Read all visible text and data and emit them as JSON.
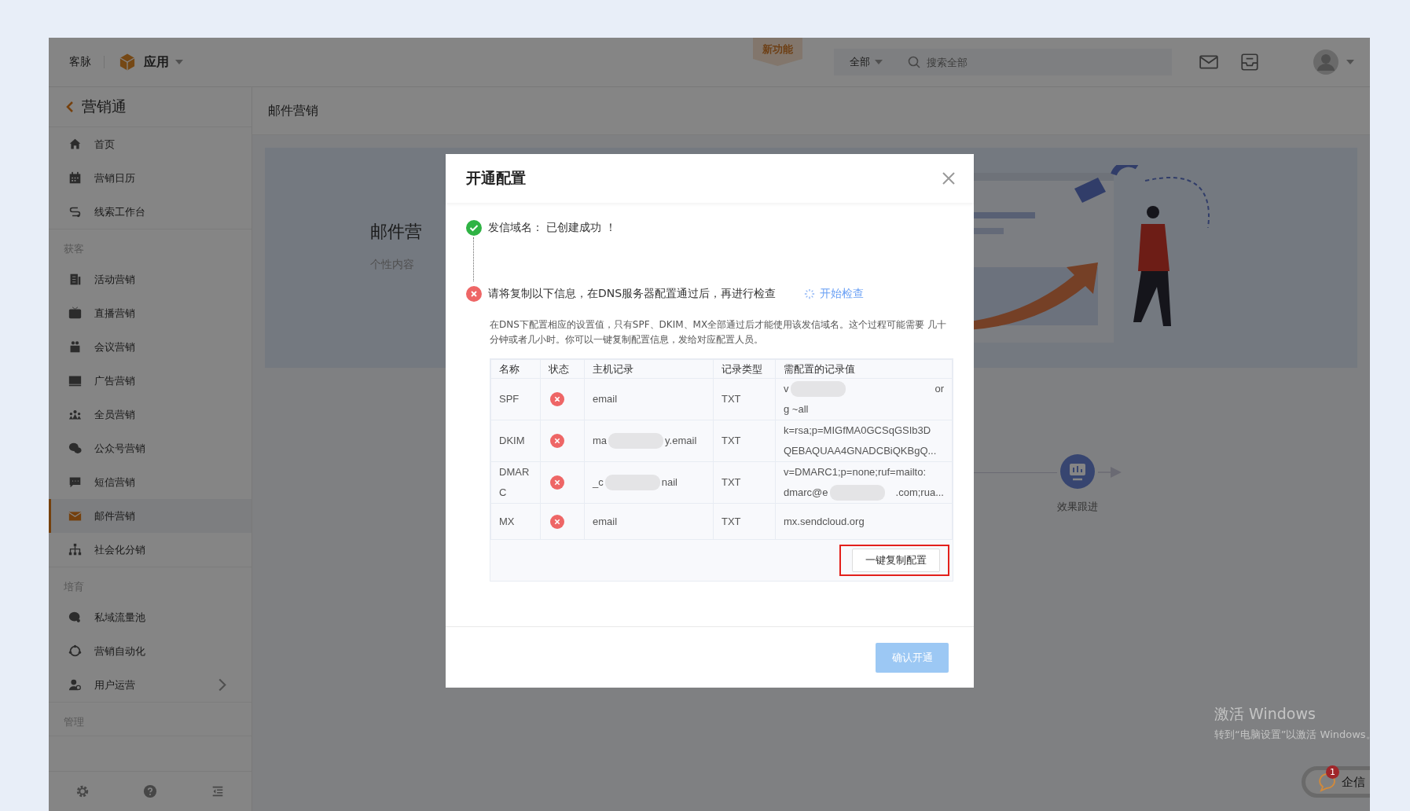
{
  "topbar": {
    "brand": "客脉",
    "app_menu": "应用",
    "new_badge": "新功能",
    "search_scope": "全部",
    "search": {
      "placeholder": "搜索全部"
    }
  },
  "sidebar": {
    "title": "营销通",
    "groups": [
      {
        "items": [
          {
            "label": "首页",
            "selected": false
          },
          {
            "label": "营销日历",
            "selected": false
          },
          {
            "label": "线索工作台",
            "selected": false
          }
        ]
      },
      {
        "heading": "获客",
        "items": [
          {
            "label": "活动营销",
            "selected": false
          },
          {
            "label": "直播营销",
            "selected": false
          },
          {
            "label": "会议营销",
            "selected": false
          },
          {
            "label": "广告营销",
            "selected": false
          },
          {
            "label": "全员营销",
            "selected": false
          },
          {
            "label": "公众号营销",
            "selected": false
          },
          {
            "label": "短信营销",
            "selected": false
          },
          {
            "label": "邮件营销",
            "selected": true
          },
          {
            "label": "社会化分销",
            "selected": false
          }
        ]
      },
      {
        "heading": "培育",
        "items": [
          {
            "label": "私域流量池",
            "selected": false
          },
          {
            "label": "营销自动化",
            "selected": false
          },
          {
            "label": "用户运营",
            "selected": false,
            "has_submenu": true
          }
        ]
      },
      {
        "heading": "管理"
      }
    ]
  },
  "main": {
    "page_title": "邮件营销",
    "banner": {
      "title": "邮件营",
      "subtitle": "个性内容"
    },
    "flow_step": "效果跟进"
  },
  "dialog": {
    "title": "开通配置",
    "steps": [
      {
        "passed": true,
        "label": "发信域名：  已创建成功  ！"
      },
      {
        "passed": false,
        "label": "请将复制以下信息，在DNS服务器配置通过后，再进行检查",
        "action": "开始检查"
      }
    ],
    "note": "在DNS下配置相应的设置值，只有SPF、DKIM、MX全部通过后才能使用该发信域名。这个过程可能需要 几十分钟或者几小时。你可以一键复制配置信息，发给对应配置人员。",
    "table": {
      "columns": [
        "名称",
        "状态",
        "主机记录",
        "记录类型",
        "需配置的记录值"
      ],
      "rows": [
        {
          "name": "SPF",
          "passed": false,
          "host": [
            "email"
          ],
          "type": "TXT",
          "value": [
            [
              "v",
              "or"
            ],
            [
              "g ~all"
            ]
          ]
        },
        {
          "name": "DKIM",
          "passed": false,
          "host": [
            "ma",
            "y.email"
          ],
          "type": "TXT",
          "value": [
            [
              "k=rsa;p=MIGfMA0GCSqGSIb3D"
            ],
            [
              "QEBAQUAA4GNADCBiQKBgQ..."
            ]
          ]
        },
        {
          "name": "DMARC",
          "passed": false,
          "host": [
            "_c",
            "nail"
          ],
          "type": "TXT",
          "value": [
            [
              "v=DMARC1;p=none;ruf=mailto:"
            ],
            [
              "dmarc@e",
              ".com;rua..."
            ]
          ]
        },
        {
          "name": "MX",
          "passed": false,
          "host": [
            "email"
          ],
          "type": "TXT",
          "value": [
            [
              "mx.sendcloud.org"
            ]
          ]
        }
      ],
      "copy_button": "一键复制配置"
    },
    "confirm_button": "确认开通"
  },
  "os_notice": {
    "title": "激活 Windows",
    "text": "转到“电脑设置”以激活 Windows。"
  },
  "chat_button": {
    "label": "企信",
    "count": "1"
  }
}
